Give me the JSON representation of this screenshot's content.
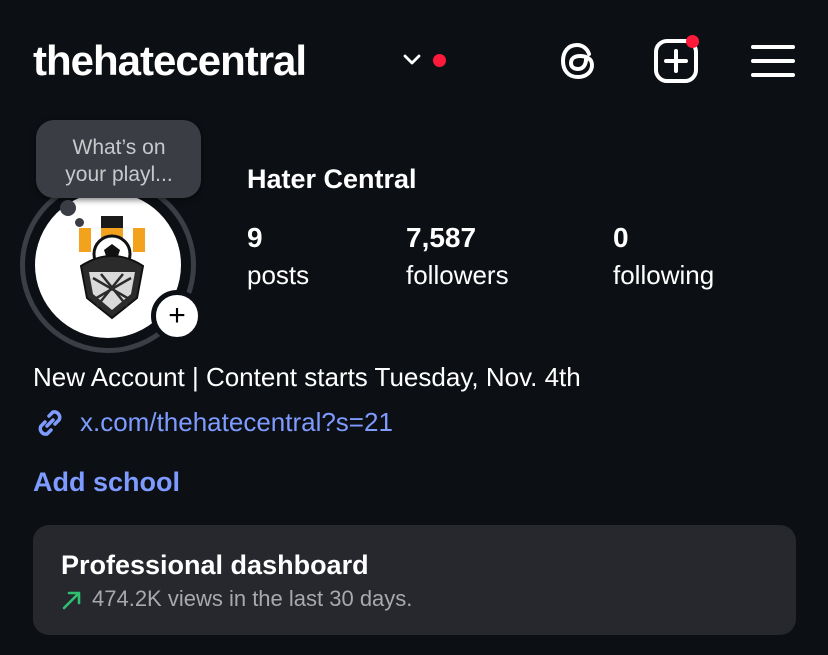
{
  "header": {
    "username": "thehatecentral",
    "icons": [
      "chevron-down-icon",
      "notification-dot",
      "threads-icon",
      "create-post-icon",
      "menu-icon"
    ],
    "notification_color": "#ff1a3b"
  },
  "profile": {
    "note_bubble": "What’s on\nyour playl...",
    "display_name": "Hater Central",
    "stats": [
      {
        "count": "9",
        "label": "posts"
      },
      {
        "count": "7,587",
        "label": "followers"
      },
      {
        "count": "0",
        "label": "following"
      }
    ],
    "bio": "New Account | Content starts Tuesday, Nov. 4th",
    "link": "x.com/thehatecentral?s=21",
    "add_school": "Add school"
  },
  "dashboard": {
    "title": "Professional dashboard",
    "subtitle": "474.2K views in the last 30 days."
  },
  "colors": {
    "background": "#0c0f14",
    "link": "#7e9bff",
    "card": "#26282e",
    "trend_up": "#2fbf71"
  }
}
